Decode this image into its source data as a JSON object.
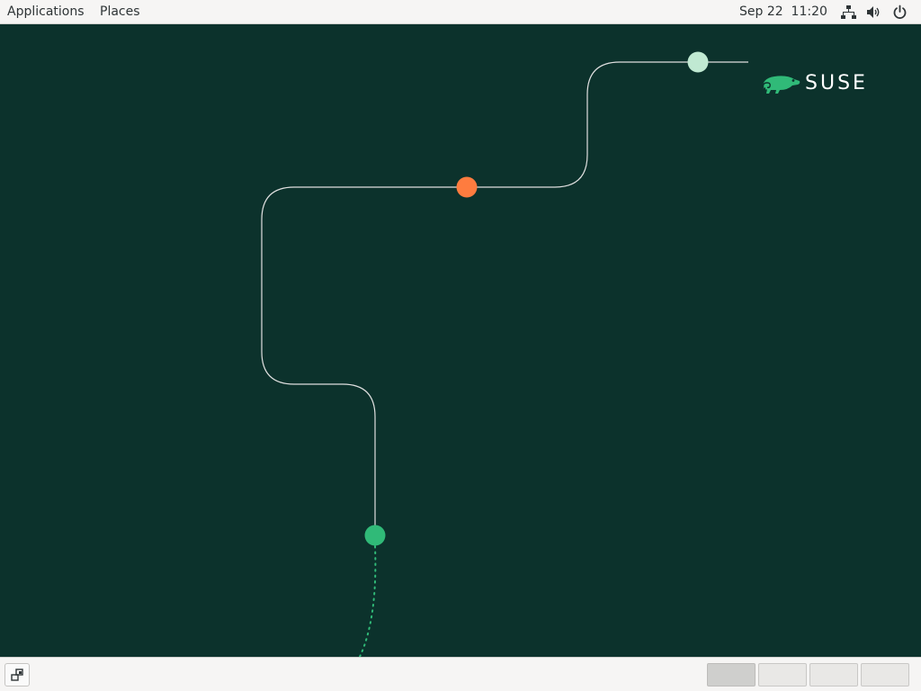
{
  "top_panel": {
    "applications_label": "Applications",
    "places_label": "Places",
    "clock": "Sep 22  11:20",
    "tray_icons": [
      "network-icon",
      "volume-icon",
      "power-icon"
    ]
  },
  "desktop": {
    "logo_text": "SUSE",
    "colors": {
      "background": "#0c322c",
      "line": "#e0e0e0",
      "dot_top": "#c0e9d2",
      "dot_middle": "#fe7c3f",
      "dot_bottom": "#30ba78",
      "logo_green": "#30ba78"
    }
  },
  "bottom_panel": {
    "show_desktop_icon": "show-desktop-icon",
    "workspaces": [
      {
        "active": true
      },
      {
        "active": false
      },
      {
        "active": false
      },
      {
        "active": false
      }
    ]
  }
}
